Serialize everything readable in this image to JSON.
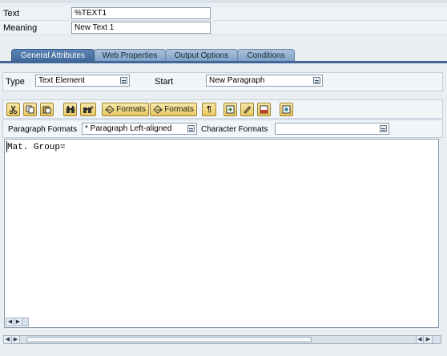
{
  "header": {
    "text_label": "Text",
    "text_value": "%TEXT1",
    "meaning_label": "Meaning",
    "meaning_value": "New Text 1"
  },
  "tabs": [
    {
      "label": "General Attributes",
      "active": true
    },
    {
      "label": "Web Properties",
      "active": false
    },
    {
      "label": "Output Options",
      "active": false
    },
    {
      "label": "Conditions",
      "active": false
    }
  ],
  "general": {
    "type_label": "Type",
    "type_value": "Text Element",
    "start_label": "Start",
    "start_value": "New Paragraph"
  },
  "toolbar": {
    "buttons": [
      {
        "name": "cut-icon"
      },
      {
        "name": "copy-icon"
      },
      {
        "name": "paste-icon"
      },
      {
        "name": "find-icon"
      },
      {
        "name": "find-next-icon"
      },
      {
        "name": "paragraph-formats-button",
        "label": "Formats"
      },
      {
        "name": "character-formats-button",
        "label": "Formats"
      },
      {
        "name": "paragraph-mark-icon",
        "label": "¶"
      },
      {
        "name": "insert-field-icon"
      },
      {
        "name": "edit-pencil-icon"
      },
      {
        "name": "graphical-editor-icon"
      },
      {
        "name": "preview-icon"
      }
    ]
  },
  "formats": {
    "paragraph_label": "Paragraph Formats",
    "paragraph_value": "* Paragraph Left-aligned",
    "character_label": "Character Formats",
    "character_value": ""
  },
  "editor": {
    "content": "Mat. Group="
  },
  "colors": {
    "active_tab": "#3f6797",
    "inactive_tab": "#8eabce",
    "toolbar_button": "#f0d880",
    "panel_bg": "#e9eef3"
  }
}
